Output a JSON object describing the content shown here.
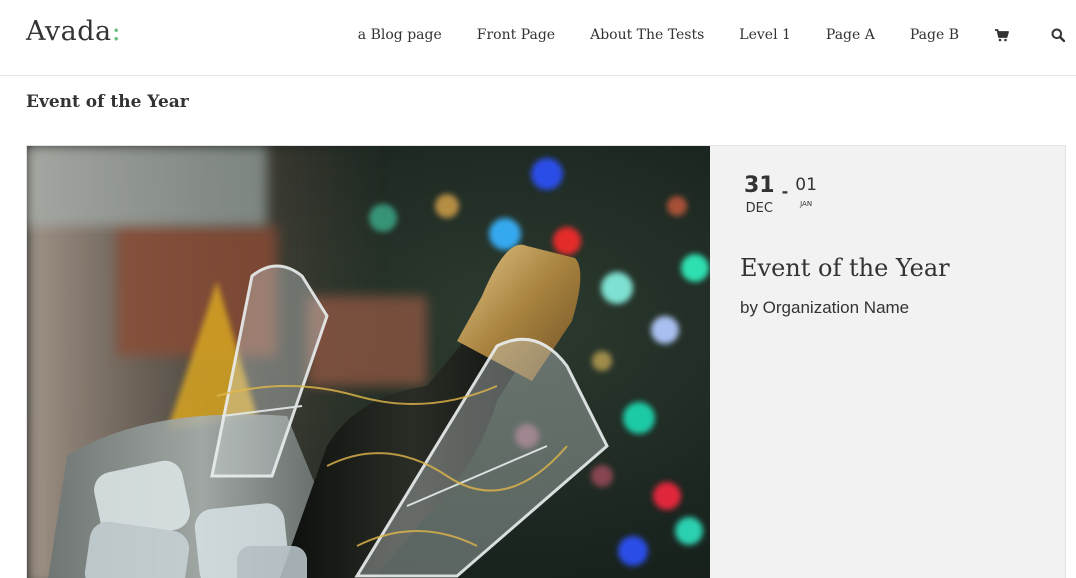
{
  "header": {
    "logo_text": "Avada",
    "logo_accent": ":",
    "nav": [
      {
        "label": "a Blog page"
      },
      {
        "label": "Front Page"
      },
      {
        "label": "About The Tests"
      },
      {
        "label": "Level 1"
      },
      {
        "label": "Page A"
      },
      {
        "label": "Page B"
      }
    ],
    "cart_icon": "cart-icon",
    "search_icon": "search-icon"
  },
  "page_title": "Event of the Year",
  "event": {
    "start_day": "31",
    "start_month": "DEC",
    "separator": "-",
    "end_day": "01",
    "end_month": "JAN",
    "title": "Event of the Year",
    "organizer": "by Organization Name",
    "image_subject": "champagne bottle in ice bucket with glasses and bokeh lights"
  },
  "colors": {
    "accent": "#65bc7b",
    "text": "#333333",
    "card_bg": "#f2f2f2"
  }
}
